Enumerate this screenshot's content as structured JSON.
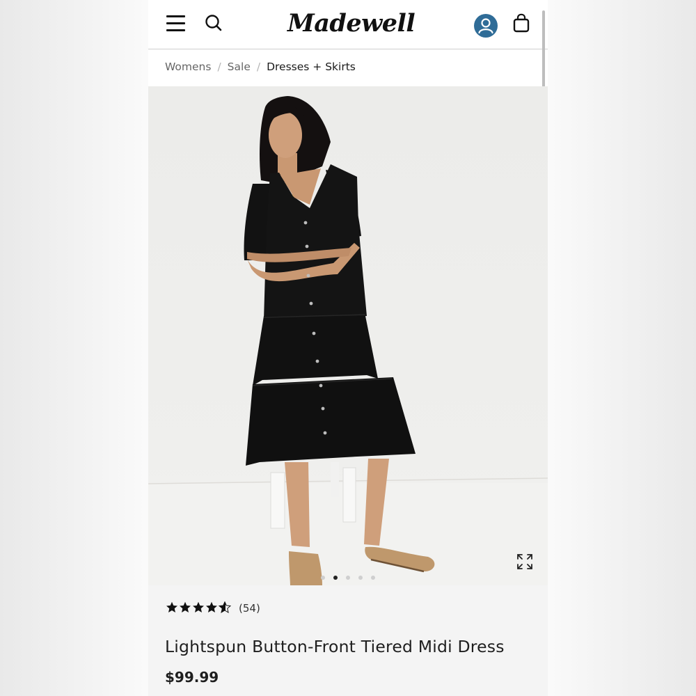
{
  "header": {
    "logo_text": "Madewell",
    "menu_icon": "hamburger-menu-icon",
    "search_icon": "search-icon",
    "account_icon": "account-icon",
    "bag_icon": "shopping-bag-icon",
    "account_color": "#2f6c97"
  },
  "breadcrumb": {
    "items": [
      "Womens",
      "Sale"
    ],
    "separator": "/",
    "current": "Dresses + Skirts"
  },
  "gallery": {
    "image_subject": "model in black button-front tiered midi dress seated on a white stool",
    "expand_icon": "expand-icon",
    "active_index": 1,
    "total": 5
  },
  "product": {
    "rating": 4.5,
    "rating_max": 5,
    "review_count": "(54)",
    "title": "Lightspun Button-Front Tiered Midi Dress",
    "price": "$99.99"
  }
}
